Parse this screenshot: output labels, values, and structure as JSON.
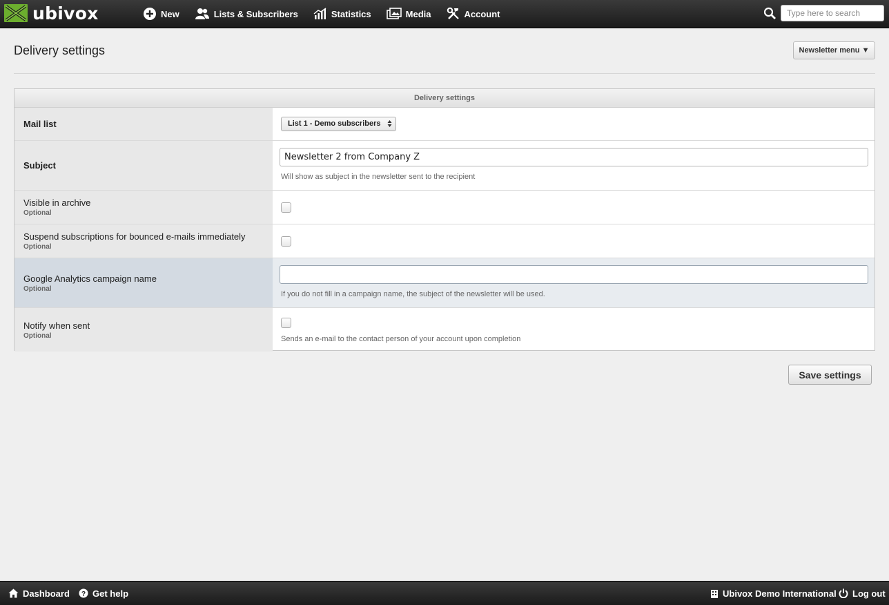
{
  "app": {
    "logo_text": "ubivox",
    "brand_green": "#6cae2e"
  },
  "nav": {
    "items": [
      {
        "label": "New",
        "icon": "plus-circle-icon"
      },
      {
        "label": "Lists & Subscribers",
        "icon": "users-icon"
      },
      {
        "label": "Statistics",
        "icon": "bar-chart-icon"
      },
      {
        "label": "Media",
        "icon": "images-icon"
      },
      {
        "label": "Account",
        "icon": "tools-icon"
      }
    ],
    "search_placeholder": "Type here to search"
  },
  "page": {
    "title": "Delivery settings",
    "newsletter_menu_label": "Newsletter menu ▼"
  },
  "panel": {
    "title": "Delivery settings",
    "optional_label": "Optional",
    "rows": {
      "mail_list": {
        "label": "Mail list",
        "value": "List 1 - Demo subscribers"
      },
      "subject": {
        "label": "Subject",
        "value": "Newsletter 2 from Company Z",
        "help": "Will show as subject in the newsletter sent to the recipient"
      },
      "archive": {
        "label": "Visible in archive",
        "optional": "Optional",
        "checked": false
      },
      "suspend": {
        "label": "Suspend subscriptions for bounced e-mails immediately",
        "optional": "Optional",
        "checked": false
      },
      "ga": {
        "label": "Google Analytics campaign name",
        "optional": "Optional",
        "value": "",
        "help": "If you do not fill in a campaign name, the subject of the newsletter will be used."
      },
      "notify": {
        "label": "Notify when sent",
        "optional": "Optional",
        "checked": false,
        "help": "Sends an e-mail to the contact person of your account upon completion"
      }
    },
    "save_label": "Save settings"
  },
  "footer": {
    "dashboard": "Dashboard",
    "help": "Get help",
    "account_name": "Ubivox Demo International",
    "logout": "Log out"
  }
}
